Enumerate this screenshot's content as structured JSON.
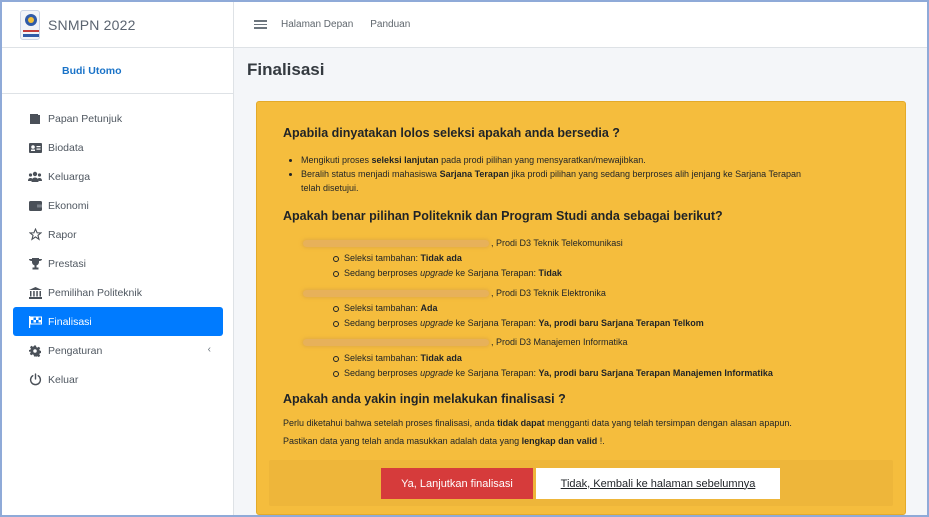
{
  "brand": {
    "title": "SNMPN 2022",
    "logo_text": "SNMPN"
  },
  "user": {
    "name": "Budi Utomo"
  },
  "sidebar": {
    "items": [
      {
        "label": "Papan Petunjuk",
        "icon": "book-icon"
      },
      {
        "label": "Biodata",
        "icon": "id-card-icon"
      },
      {
        "label": "Keluarga",
        "icon": "users-icon"
      },
      {
        "label": "Ekonomi",
        "icon": "wallet-icon"
      },
      {
        "label": "Rapor",
        "icon": "star-icon"
      },
      {
        "label": "Prestasi",
        "icon": "trophy-icon"
      },
      {
        "label": "Pemilihan Politeknik",
        "icon": "university-icon"
      },
      {
        "label": "Finalisasi",
        "icon": "flag-checkered-icon"
      },
      {
        "label": "Pengaturan",
        "icon": "gear-icon"
      },
      {
        "label": "Keluar",
        "icon": "power-icon"
      }
    ],
    "collapse_glyph": "‹"
  },
  "topbar": {
    "menu_icon": "hamburger-icon",
    "links": [
      "Halaman Depan",
      "Panduan"
    ]
  },
  "page": {
    "title": "Finalisasi"
  },
  "card": {
    "section1": {
      "heading": "Apabila dinyatakan lolos seleksi apakah anda bersedia ?",
      "bullet1": {
        "pre": "Mengikuti proses ",
        "bold": "seleksi lanjutan",
        "post": " pada prodi pilihan yang mensyaratkan/mewajibkan."
      },
      "bullet2": {
        "pre": "Beralih status menjadi mahasiswa ",
        "bold": "Sarjana Terapan",
        "post": " jika prodi pilihan yang sedang berproses alih jenjang ke Sarjana Terapan",
        "line2": "telah disetujui."
      }
    },
    "section2": {
      "heading": "Apakah benar pilihan Politeknik dan Program Studi anda sebagai berikut?",
      "choices": [
        {
          "prodi": ", Prodi D3 Teknik Telekomunikasi",
          "seleksi_label": "Seleksi tambahan: ",
          "seleksi_value": "Tidak ada",
          "upgrade_pre": "Sedang berproses ",
          "upgrade_word": "upgrade",
          "upgrade_post": " ke Sarjana Terapan: ",
          "upgrade_value": "Tidak"
        },
        {
          "prodi": ", Prodi D3 Teknik Elektronika",
          "seleksi_label": "Seleksi tambahan: ",
          "seleksi_value": "Ada",
          "upgrade_pre": "Sedang berproses ",
          "upgrade_word": "upgrade",
          "upgrade_post": " ke Sarjana Terapan: ",
          "upgrade_value": "Ya, prodi baru Sarjana Terapan Telkom"
        },
        {
          "prodi": ", Prodi D3 Manajemen Informatika",
          "seleksi_label": "Seleksi tambahan: ",
          "seleksi_value": "Tidak ada",
          "upgrade_pre": "Sedang berproses ",
          "upgrade_word": "upgrade",
          "upgrade_post": " ke Sarjana Terapan: ",
          "upgrade_value": "Ya, prodi baru Sarjana Terapan Manajemen Informatika"
        }
      ]
    },
    "section3": {
      "heading": "Apakah anda yakin ingin melakukan finalisasi ?",
      "p1": {
        "pre": "Perlu diketahui bahwa setelah proses finalisasi, anda ",
        "bold": "tidak dapat",
        "post": " mengganti data yang telah tersimpan dengan alasan apapun."
      },
      "p2": {
        "pre": "Pastikan data yang telah anda masukkan adalah data yang ",
        "bold": "lengkap dan valid",
        "post": " !."
      }
    },
    "buttons": {
      "confirm": "Ya, Lanjutkan finalisasi",
      "cancel": "Tidak, Kembali ke halaman sebelumnya"
    }
  },
  "colors": {
    "warning": "#f5bd3d",
    "active": "#007bff",
    "danger": "#d63b3b",
    "brand_text": "#5b6470",
    "user_name": "#1a73c8"
  }
}
